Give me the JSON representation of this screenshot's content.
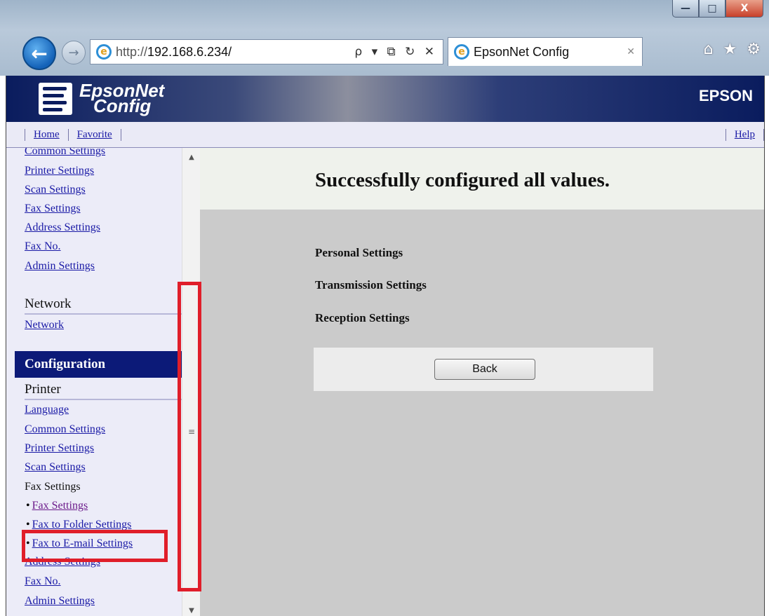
{
  "window": {
    "controls": [
      "—",
      "□",
      "X"
    ]
  },
  "browser": {
    "url_prefix": "http://",
    "url_host": "192.168.6.234/",
    "address_tools": "ρ ▾ ⧉ ↻ ✕",
    "tab_title": "EpsonNet Config",
    "tab_close": "✕",
    "tools": [
      "⌂",
      "★",
      "⚙"
    ]
  },
  "header": {
    "brand_line1": "EpsonNet",
    "brand_line2": "Config",
    "vendor": "EPSON"
  },
  "linkbar": {
    "home": "Home",
    "favorite": "Favorite",
    "help": "Help"
  },
  "sidebar": {
    "top_links": [
      "Common Settings",
      "Printer Settings",
      "Scan Settings",
      "Fax Settings",
      "Address Settings",
      "Fax No.",
      "Admin Settings"
    ],
    "network_heading": "Network",
    "network_link": "Network",
    "configuration": "Configuration",
    "printer_heading": "Printer",
    "printer_links": [
      "Language",
      "Common Settings",
      "Printer Settings",
      "Scan Settings"
    ],
    "fax_settings_label": "Fax Settings",
    "fax_sub": [
      "Fax Settings",
      "Fax to Folder Settings",
      "Fax to E-mail Settings"
    ],
    "bottom_links": [
      "Address Settings",
      "Fax No.",
      "Admin Settings"
    ]
  },
  "main": {
    "success_message": "Successfully configured all values.",
    "sections": [
      "Personal Settings",
      "Transmission Settings",
      "Reception Settings"
    ],
    "back_button": "Back"
  },
  "colors": {
    "highlight": "#e01e2a",
    "nav_bar": "#0c1a78",
    "link": "#1a1aa6"
  }
}
